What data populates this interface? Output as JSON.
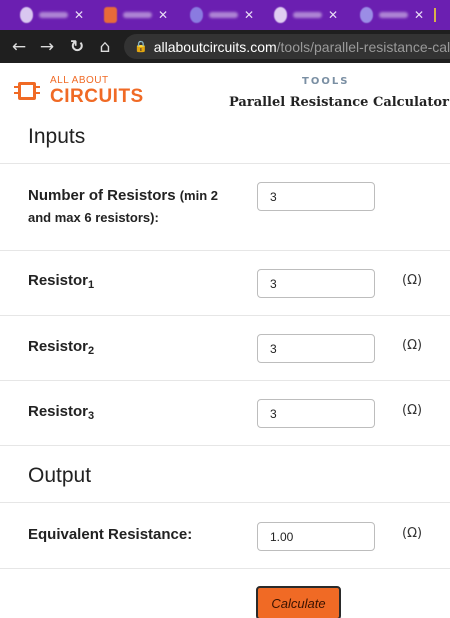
{
  "browser": {
    "tab_count": 5,
    "url_host": "allaboutcircuits.com",
    "url_path": "/tools/parallel-resistance-calculator/"
  },
  "site": {
    "logo_small": "ALL ABOUT",
    "logo_big": "CIRCUITS",
    "section_label": "TOOLS",
    "page_title": "Parallel Resistance Calculator",
    "brand_color": "#f06a25"
  },
  "inputs": {
    "heading": "Inputs",
    "num_resistors_label": "Number of Resistors",
    "num_resistors_hint_a": "(min 2",
    "num_resistors_hint_b": "and max 6 resistors):",
    "num_resistors_value": "3",
    "resistor_word": "Resistor",
    "resistors": [
      {
        "index": "1",
        "value": "3",
        "unit": "(Ω)"
      },
      {
        "index": "2",
        "value": "3",
        "unit": "(Ω)"
      },
      {
        "index": "3",
        "value": "3",
        "unit": "(Ω)"
      }
    ]
  },
  "output": {
    "heading": "Output",
    "equiv_label": "Equivalent Resistance:",
    "equiv_value": "1.00",
    "unit": "(Ω)"
  },
  "actions": {
    "calculate_label": "Calculate"
  }
}
